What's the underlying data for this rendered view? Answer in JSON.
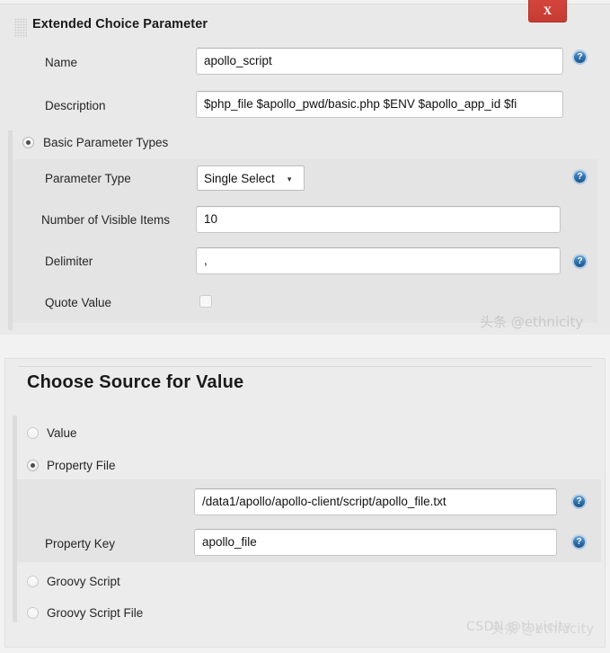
{
  "window": {
    "close_label": "X"
  },
  "choice_panel": {
    "title": "Extended Choice Parameter",
    "drag_handle_icon": "drag-grid-icon",
    "fields": [
      {
        "label": "Name",
        "value": "apollo_script",
        "help": "?"
      },
      {
        "label": "Description",
        "value": "$php_file $apollo_pwd/basic.php $ENV $apollo_app_id   $fi",
        "help": ""
      }
    ],
    "basic_types": {
      "label": "Basic Parameter Types",
      "selected": true
    },
    "parameter_type": {
      "label": "Parameter Type",
      "value": "Single Select",
      "caret": "▾",
      "help": "?"
    },
    "visible_items": {
      "label": "Number of Visible Items",
      "value": "10"
    },
    "delimiter": {
      "label": "Delimiter",
      "value": ",",
      "help": "?"
    },
    "quote_value": {
      "label": "Quote Value",
      "checked": false
    },
    "watermark": "头条 @ethnicity"
  },
  "source_panel": {
    "title": "Choose Source for Value",
    "options": [
      {
        "label": "Value",
        "selected": false
      },
      {
        "label": "Property File",
        "selected": true
      },
      {
        "label": "Groovy Script",
        "selected": false
      },
      {
        "label": "Groovy Script File",
        "selected": false
      }
    ],
    "property_file_path": {
      "label": "",
      "value": "/data1/apollo/apollo-client/script/apollo_file.txt",
      "help": "?"
    },
    "property_key": {
      "label": "Property Key",
      "value": "apollo_file",
      "help": "?"
    },
    "watermark_csdn": "CSDN @thyicity",
    "watermark_toutiao": "头条 @ethnicity"
  },
  "icons": {
    "help": "?"
  }
}
